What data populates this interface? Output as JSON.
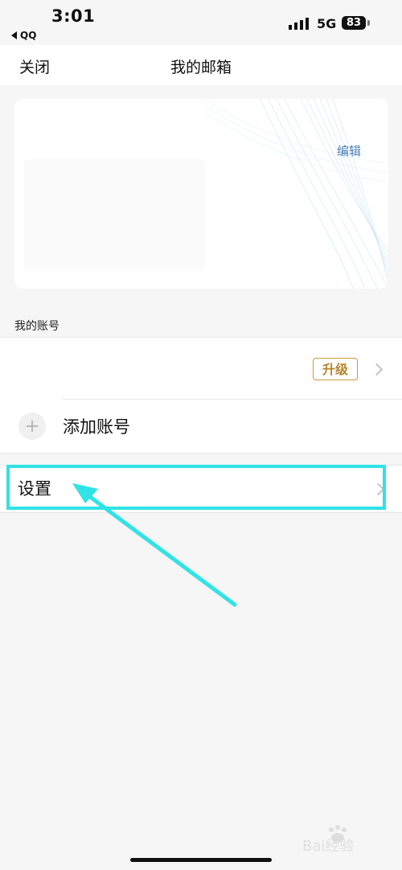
{
  "status_bar": {
    "time": "3:01",
    "back_app": "QQ",
    "network": "5G",
    "battery": "83"
  },
  "nav": {
    "close_label": "关闭",
    "title": "我的邮箱"
  },
  "banner": {
    "edit_label": "编辑"
  },
  "accounts_section": {
    "label": "我的账号",
    "upgrade_label": "升级",
    "add_account_label": "添加账号"
  },
  "settings": {
    "label": "设置"
  },
  "colors": {
    "highlight": "#2fe3e6",
    "upgrade_gold": "#c79a3f",
    "edit_blue": "#4a7fb5"
  },
  "watermark": {
    "text": "Bai经验"
  }
}
